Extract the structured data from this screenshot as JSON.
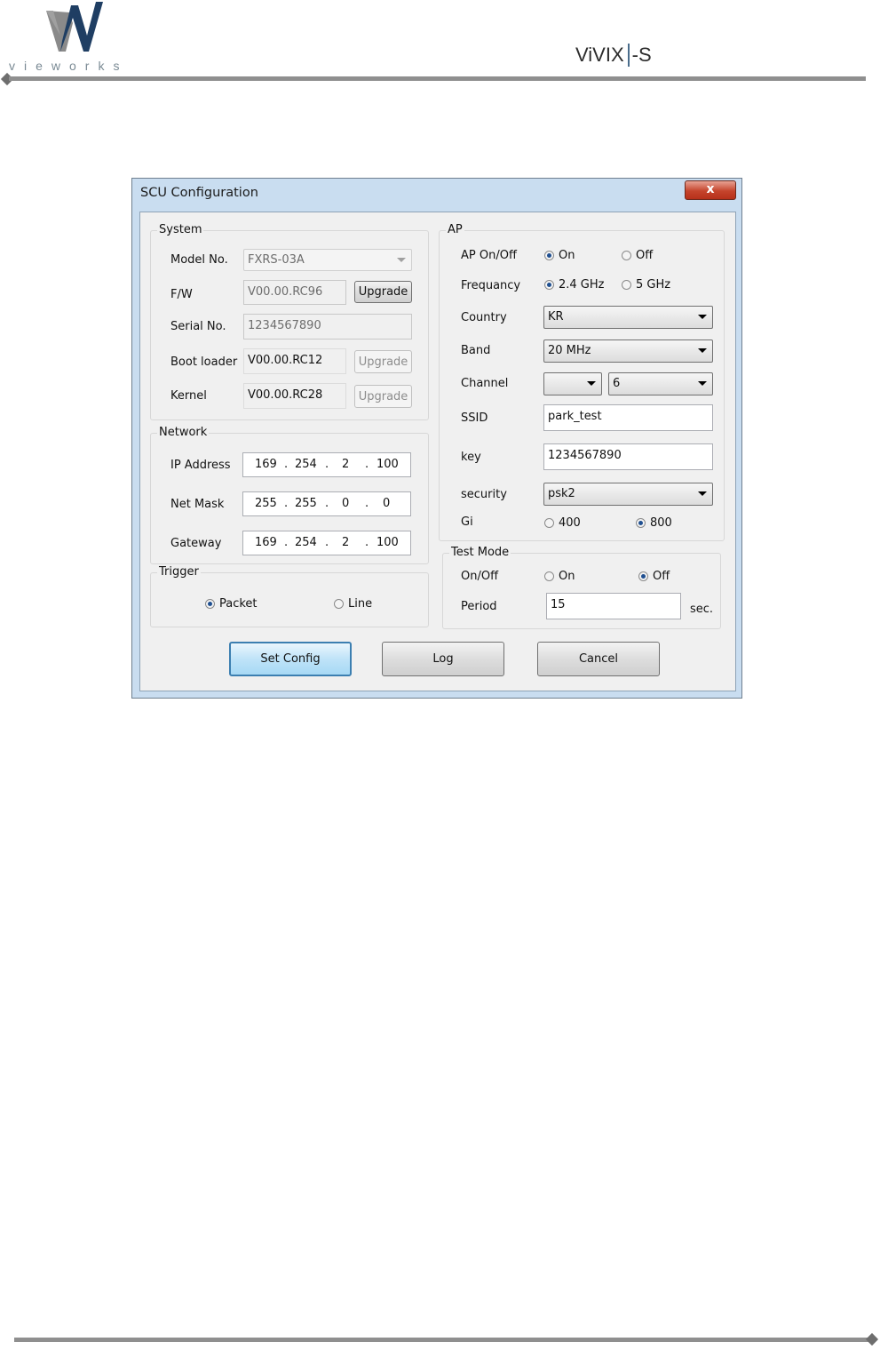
{
  "header": {
    "brand_text": "vieworks",
    "product_logo": "ViVIX",
    "product_suffix": "-S",
    "brand_color": "#7d8a93"
  },
  "window": {
    "title": "SCU Configuration",
    "close_label": "x",
    "system": {
      "title": "System",
      "model_label": "Model No.",
      "model_value": "FXRS-03A",
      "fw_label": "F/W",
      "fw_value": "V00.00.RC96",
      "fw_upgrade": "Upgrade",
      "serial_label": "Serial No.",
      "serial_value": "1234567890",
      "bootloader_label": "Boot loader",
      "bootloader_value": "V00.00.RC12",
      "bootloader_upgrade": "Upgrade",
      "kernel_label": "Kernel",
      "kernel_value": "V00.00.RC28",
      "kernel_upgrade": "Upgrade"
    },
    "network": {
      "title": "Network",
      "ip_label": "IP Address",
      "ip": [
        "169",
        "254",
        "2",
        "100"
      ],
      "mask_label": "Net Mask",
      "mask": [
        "255",
        "255",
        "0",
        "0"
      ],
      "gateway_label": "Gateway",
      "gateway": [
        "169",
        "254",
        "2",
        "100"
      ],
      "dot": "."
    },
    "trigger": {
      "title": "Trigger",
      "packet": "Packet",
      "line": "Line",
      "selected": "Packet"
    },
    "ap": {
      "title": "AP",
      "onoff_label": "AP On/Off",
      "on": "On",
      "off": "Off",
      "onoff_selected": "On",
      "freq_label": "Frequancy",
      "freq_24": "2.4 GHz",
      "freq_5": "5 GHz",
      "freq_selected": "2.4 GHz",
      "country_label": "Country",
      "country_value": "KR",
      "band_label": "Band",
      "band_value": "20 MHz",
      "channel_label": "Channel",
      "channel_value_1": "",
      "channel_value_2": "6",
      "ssid_label": "SSID",
      "ssid_value": "park_test",
      "key_label": "key",
      "key_value": "1234567890",
      "security_label": "security",
      "security_value": "psk2",
      "gi_label": "Gi",
      "gi_400": "400",
      "gi_800": "800",
      "gi_selected": "800"
    },
    "test_mode": {
      "title": "Test Mode",
      "onoff_label": "On/Off",
      "on": "On",
      "off": "Off",
      "selected": "Off",
      "period_label": "Period",
      "period_value": "15",
      "period_unit": "sec."
    },
    "buttons": {
      "set_config": "Set Config",
      "log": "Log",
      "cancel": "Cancel"
    }
  }
}
